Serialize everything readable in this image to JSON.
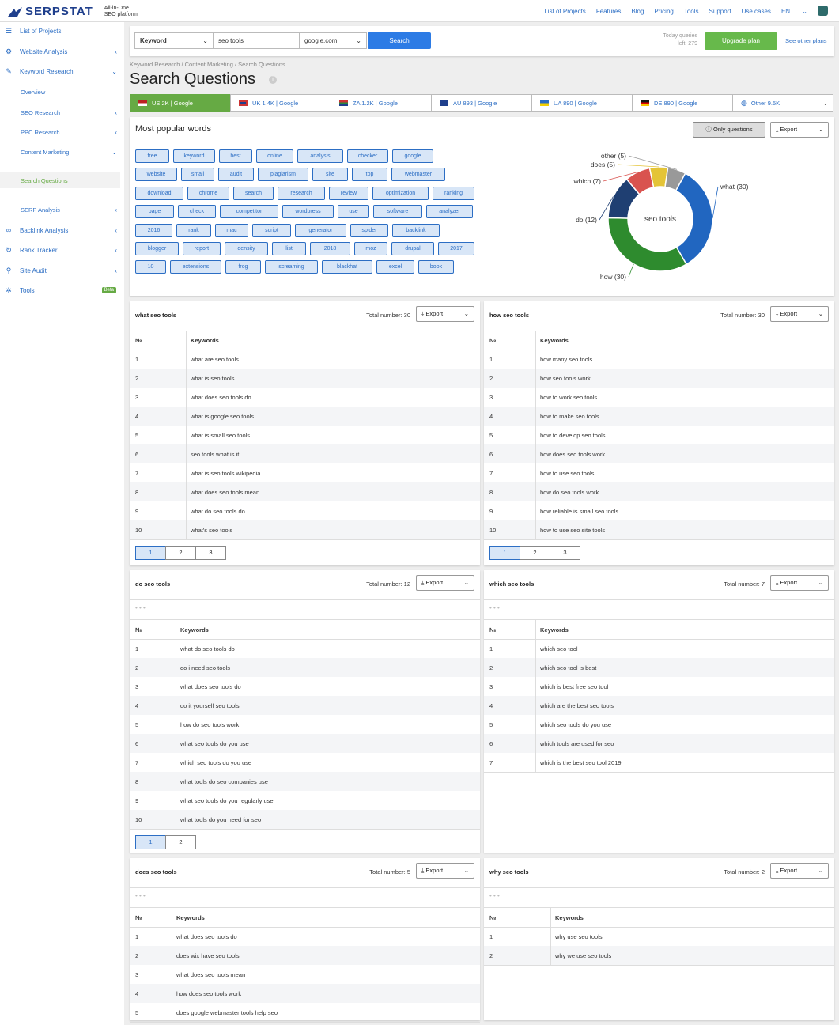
{
  "brand": {
    "name": "SERPSTAT",
    "tagline1": "All-in-One",
    "tagline2": "SEO platform"
  },
  "topnav": {
    "items": [
      "List of Projects",
      "Features",
      "Blog",
      "Pricing",
      "Tools",
      "Support",
      "Use cases",
      "EN"
    ]
  },
  "sidebar": {
    "items": [
      {
        "label": "List of Projects",
        "icon": "list-icon"
      },
      {
        "label": "Website Analysis",
        "icon": "analysis-icon"
      },
      {
        "label": "Keyword Research",
        "icon": "key-icon"
      },
      {
        "label": "Overview"
      },
      {
        "label": "SEO Research"
      },
      {
        "label": "PPC Research"
      },
      {
        "label": "Content Marketing"
      },
      {
        "label": "Search Questions"
      },
      {
        "label": "SERP Analysis"
      },
      {
        "label": "Backlink Analysis",
        "icon": "link-icon"
      },
      {
        "label": "Rank Tracker",
        "icon": "tracker-icon"
      },
      {
        "label": "Site Audit",
        "icon": "audit-icon"
      },
      {
        "label": "Tools",
        "icon": "gear-icon",
        "badge": "Beta"
      }
    ]
  },
  "search": {
    "type": "Keyword",
    "query": "seo tools",
    "engine": "google.com",
    "button": "Search",
    "queries_label": "Today queries",
    "queries_left": "left: 279",
    "upgrade": "Upgrade plan",
    "other_plans": "See other plans"
  },
  "breadcrumb": "Keyword Research / Content Marketing / Search Questions",
  "page_title": "Search Questions",
  "db_tabs": [
    "US 2K | Google",
    "UK 1.4K | Google",
    "ZA 1.2K | Google",
    "AU 893 | Google",
    "UA 890 | Google",
    "DE 890 | Google",
    "Other 9.5K"
  ],
  "popular": {
    "title": "Most popular words",
    "only_questions": "Only questions",
    "export": "Export",
    "words": [
      "free",
      "keyword",
      "best",
      "online",
      "analysis",
      "checker",
      "google",
      "website",
      "small",
      "audit",
      "plagiarism",
      "site",
      "top",
      "webmaster",
      "download",
      "chrome",
      "search",
      "research",
      "review",
      "optimization",
      "ranking",
      "page",
      "check",
      "competitor",
      "wordpress",
      "use",
      "software",
      "analyzer",
      "2016",
      "rank",
      "mac",
      "script",
      "generator",
      "spider",
      "backlink",
      "blogger",
      "report",
      "density",
      "list",
      "2018",
      "moz",
      "drupal",
      "2017",
      "10",
      "extensions",
      "frog",
      "screaming",
      "blackhat",
      "excel",
      "book"
    ]
  },
  "chart_data": {
    "type": "pie",
    "title": "seo tools",
    "categories": [
      "what",
      "how",
      "do",
      "which",
      "does",
      "other"
    ],
    "values": [
      30,
      30,
      12,
      7,
      5,
      5
    ],
    "labels": [
      "what (30)",
      "how (30)",
      "do (12)",
      "which (7)",
      "does (5)",
      "other (5)"
    ],
    "colors": [
      "#2166c0",
      "#2e8b2e",
      "#1f3f72",
      "#d9534f",
      "#e4c437",
      "#999999"
    ]
  },
  "tables_common": {
    "no": "№",
    "keywords": "Keywords",
    "export": "Export"
  },
  "cards": [
    {
      "title": "what seo tools",
      "total": "Total number: 30",
      "rows": [
        "what are seo tools",
        "what is seo tools",
        "what does seo tools do",
        "what is google seo tools",
        "what is small seo tools",
        "seo tools what is it",
        "what is seo tools wikipedia",
        "what does seo tools mean",
        "what do seo tools do",
        "what's seo tools"
      ],
      "pages": [
        "1",
        "2",
        "3"
      ]
    },
    {
      "title": "how seo tools",
      "total": "Total number: 30",
      "rows": [
        "how many seo tools",
        "how seo tools work",
        "how to work seo tools",
        "how to make seo tools",
        "how to develop seo tools",
        "how does seo tools work",
        "how to use seo tools",
        "how do seo tools work",
        "how reliable is small seo tools",
        "how to use seo site tools"
      ],
      "pages": [
        "1",
        "2",
        "3"
      ]
    },
    {
      "title": "do seo tools",
      "total": "Total number: 12",
      "rows": [
        "what do seo tools do",
        "do i need seo tools",
        "what does seo tools do",
        "do it yourself seo tools",
        "how do seo tools work",
        "what seo tools do you use",
        "which seo tools do you use",
        "what tools do seo companies use",
        "what seo tools do you regularly use",
        "what tools do you need for seo"
      ],
      "pages": [
        "1",
        "2"
      ]
    },
    {
      "title": "which seo tools",
      "total": "Total number: 7",
      "rows": [
        "which seo tool",
        "which seo tool is best",
        "which is best free seo tool",
        "which are the best seo tools",
        "which seo tools do you use",
        "which tools are used for seo",
        "which is the best seo tool 2019"
      ],
      "pages": []
    },
    {
      "title": "does seo tools",
      "total": "Total number: 5",
      "rows": [
        "what does seo tools do",
        "does wix have seo tools",
        "what does seo tools mean",
        "how does seo tools work",
        "does google webmaster tools help seo"
      ],
      "pages": []
    },
    {
      "title": "why seo tools",
      "total": "Total number: 2",
      "rows": [
        "why use seo tools",
        "why we use seo tools"
      ],
      "pages": []
    }
  ]
}
